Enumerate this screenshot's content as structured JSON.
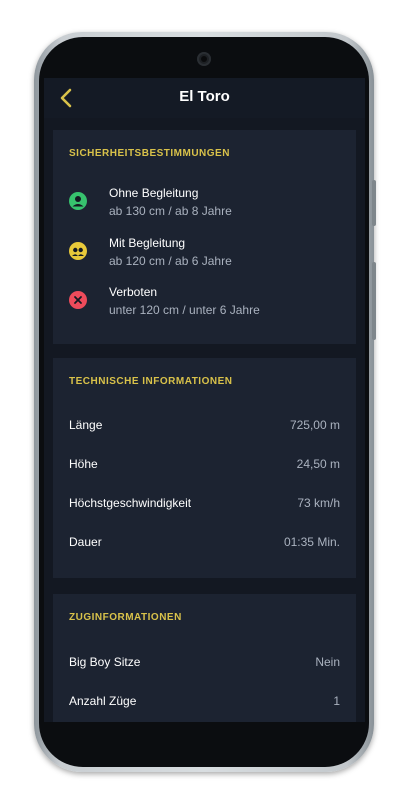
{
  "header": {
    "title": "El Toro"
  },
  "safety": {
    "title": "SICHERHEITSBESTIMMUNGEN",
    "items": [
      {
        "icon": "person-circle-icon",
        "color": "#37c26e",
        "name": "Ohne Begleitung",
        "detail": "ab 130 cm / ab 8 Jahre"
      },
      {
        "icon": "group-circle-icon",
        "color": "#e8c93a",
        "name": "Mit Begleitung",
        "detail": "ab 120 cm / ab 6 Jahre"
      },
      {
        "icon": "close-circle-icon",
        "color": "#ef4b5b",
        "name": "Verboten",
        "detail": "unter 120 cm / unter 6 Jahre"
      }
    ]
  },
  "technical": {
    "title": "TECHNISCHE INFORMATIONEN",
    "rows": [
      {
        "label": "Länge",
        "value": "725,00 m"
      },
      {
        "label": "Höhe",
        "value": "24,50 m"
      },
      {
        "label": "Höchstgeschwindigkeit",
        "value": "73 km/h"
      },
      {
        "label": "Dauer",
        "value": "01:35 Min."
      }
    ]
  },
  "train": {
    "title": "ZUGINFORMATIONEN",
    "rows": [
      {
        "label": "Big Boy Sitze",
        "value": "Nein"
      },
      {
        "label": "Anzahl Züge",
        "value": "1"
      }
    ]
  },
  "colors": {
    "accent": "#d9c24a",
    "background": "#131822",
    "card": "#1c2331"
  }
}
